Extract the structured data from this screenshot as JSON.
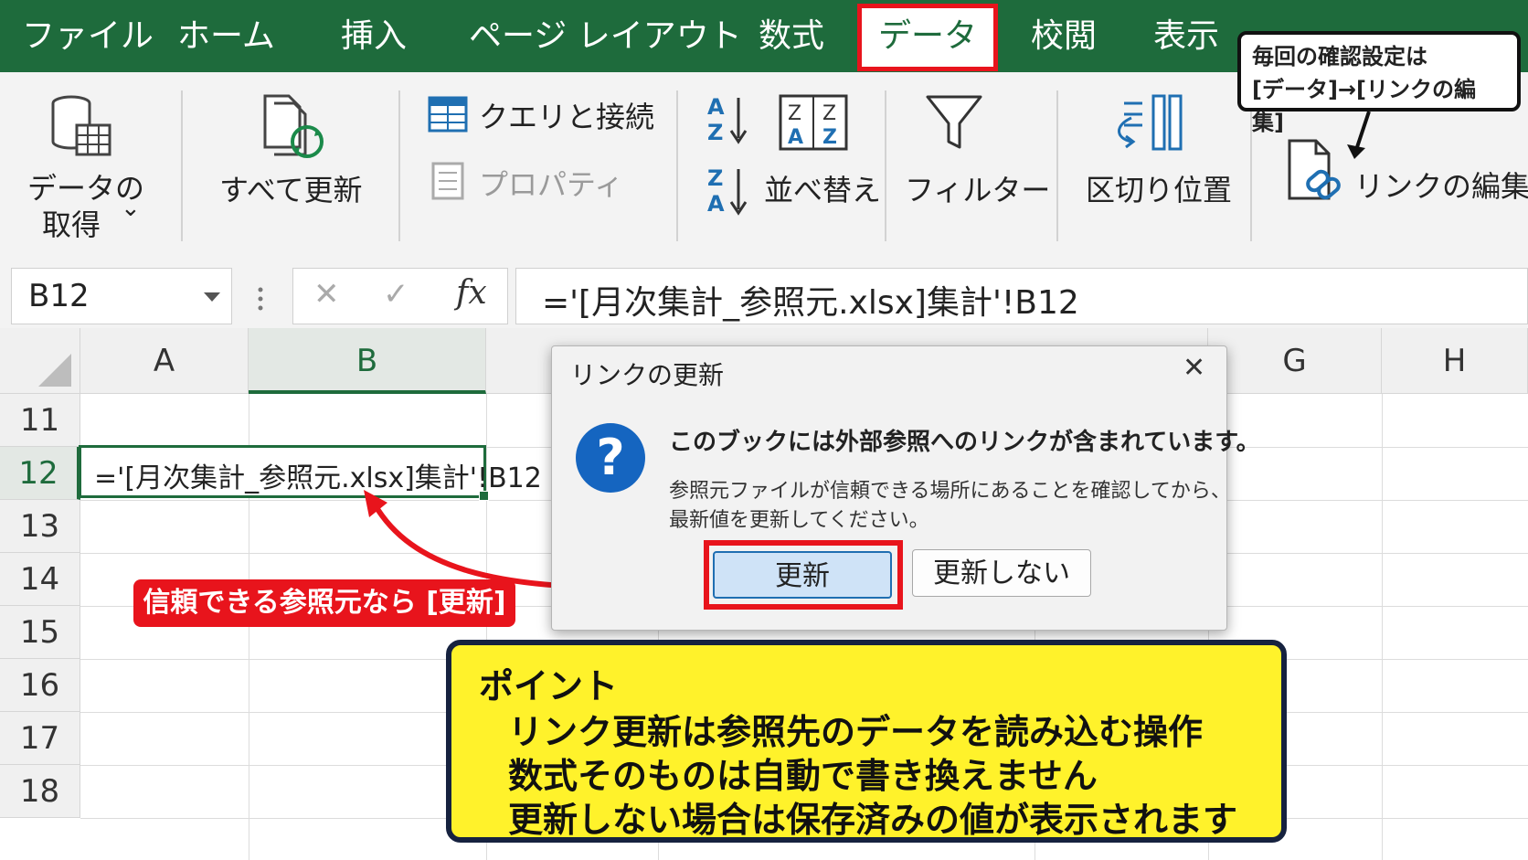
{
  "tabs": [
    "ファイル",
    "ホーム",
    "挿入",
    "ページ レイアウト",
    "数式",
    "データ",
    "校閲",
    "表示"
  ],
  "active_tab": "データ",
  "top_note": {
    "line1": "毎回の確認設定は",
    "line2": "[データ]→[リンクの編集]"
  },
  "ribbon": {
    "get_data_line1": "データの",
    "get_data_line2": "取得",
    "get_data_caret": "⌄",
    "refresh_all": "すべて更新",
    "queries": "クエリと接続",
    "properties": "プロパティ",
    "sort": "並べ替え",
    "filter": "フィルター",
    "text_to_columns": "区切り位置",
    "edit_links": "リンクの編集"
  },
  "formula_bar": {
    "name_box": "B12",
    "cancel": "✕",
    "enter": "✓",
    "fx": "fx",
    "formula": "='[月次集計_参照元.xlsx]集計'!B12"
  },
  "grid": {
    "columns": [
      "A",
      "B",
      "G",
      "H"
    ],
    "rows": [
      "11",
      "12",
      "13",
      "14",
      "15",
      "16",
      "17",
      "18"
    ],
    "active_cell_value": "='[月次集計_参照元.xlsx]集計'!B12"
  },
  "dialog": {
    "title": "リンクの更新",
    "close": "✕",
    "icon": "?",
    "heading": "このブックには外部参照へのリンクが含まれています。",
    "body_line1": "参照元ファイルが信頼できる場所にあることを確認してから、",
    "body_line2": "最新値を更新してください。",
    "update_button": "更新",
    "dont_update_button": "更新しない"
  },
  "red_tag": "信頼できる参照元なら [更新]",
  "point": {
    "title": "ポイント",
    "line1": "リンク更新は参照先のデータを読み込む操作",
    "line2": "数式そのものは自動で書き換えません",
    "line3": "更新しない場合は保存済みの値が表示されます"
  },
  "colors": {
    "excel_green": "#1e6b3c",
    "highlight_red": "#e8141c",
    "note_yellow": "#fff22b",
    "help_blue": "#1565c0"
  }
}
